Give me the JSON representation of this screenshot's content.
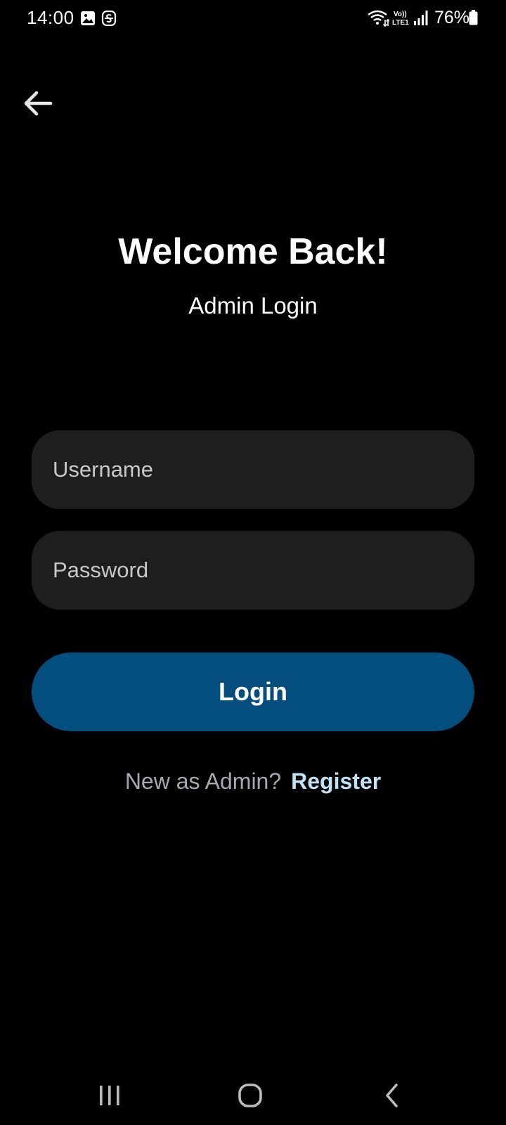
{
  "status_bar": {
    "time": "14:00",
    "battery_percent": "76%",
    "icons": [
      "gallery-icon",
      "s-app-icon",
      "wifi-icon",
      "volte-lte-icon",
      "signal-icon",
      "battery-icon"
    ],
    "volte_label": "Vo)) LTE1"
  },
  "header": {
    "back_icon": "arrow-left-icon"
  },
  "main": {
    "title": "Welcome Back!",
    "subtitle": "Admin Login",
    "username": {
      "placeholder": "Username",
      "value": ""
    },
    "password": {
      "placeholder": "Password",
      "value": ""
    },
    "login_label": "Login",
    "register_prompt": "New as Admin?",
    "register_label": "Register"
  },
  "nav_bar": {
    "icons": [
      "recent-apps-icon",
      "home-icon",
      "back-icon"
    ]
  },
  "colors": {
    "background": "#000000",
    "field_background": "#1e1e1e",
    "button_accent": "#034e7c",
    "register_link": "#c1e1f7",
    "prompt_text": "#a7a9b1"
  }
}
